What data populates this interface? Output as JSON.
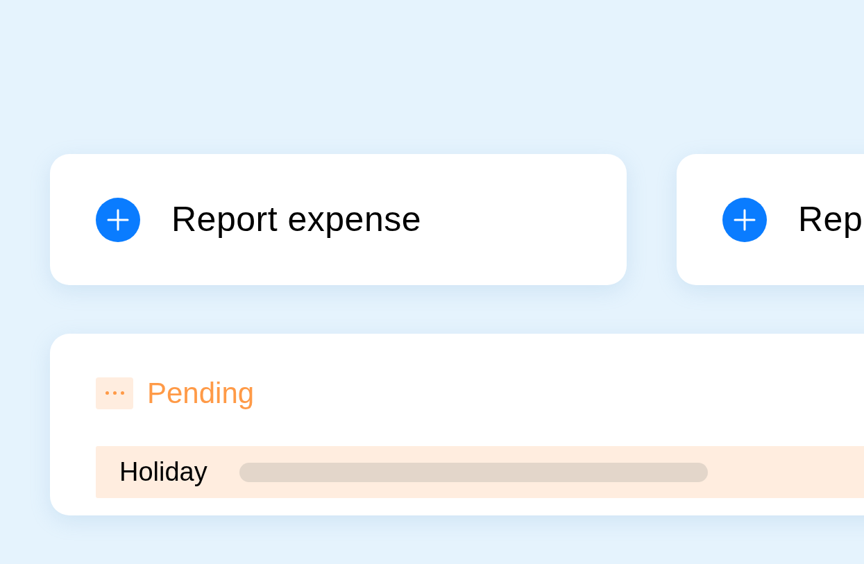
{
  "action_cards": [
    {
      "label": "Report expense"
    },
    {
      "label": "Rep"
    }
  ],
  "status_card": {
    "status": {
      "kind": "pending",
      "label": "Pending"
    },
    "rows": [
      {
        "label": "Holiday"
      }
    ]
  }
}
